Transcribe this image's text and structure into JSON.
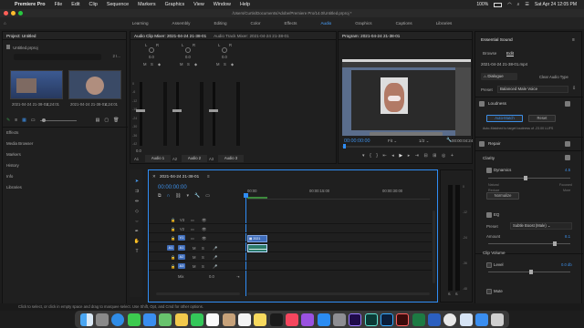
{
  "menubar": {
    "app": "Premiere Pro",
    "items": [
      "File",
      "Edit",
      "Clip",
      "Sequence",
      "Markers",
      "Graphics",
      "View",
      "Window",
      "Help"
    ],
    "battery": "100%",
    "datetime": "Sat Apr 24  12:05 PM"
  },
  "path": "/Users/Curtis/Documents/Adobe/Premiere Pro/14.0/Untitled.prproj *",
  "workspaces": [
    "Learning",
    "Assembly",
    "Editing",
    "Color",
    "Effects",
    "Audio",
    "Graphics",
    "Captions",
    "Libraries"
  ],
  "active_workspace": "Audio",
  "project": {
    "tab": "Project: Untitled",
    "file": "Untitled.prproj",
    "count": "2 I...",
    "items": [
      {
        "name": "2021-04-24 21-38-01...",
        "dur": "4;24:01"
      },
      {
        "name": "2021-04-24 21-38-01...",
        "dur": "4;24:01"
      }
    ],
    "sidebar": [
      "Effects",
      "Media Browser",
      "Markers",
      "History",
      "Info",
      "Libraries"
    ]
  },
  "mixer": {
    "tabs": [
      "Audio Clip Mixer: 2021-04-24 21-38-01",
      "Audio Track Mixer: 2021-04-24 21-38-01"
    ],
    "left_label": "L",
    "right_label": "R",
    "value": "0.0",
    "channel_names": [
      "Audio 1",
      "Audio 2",
      "Audio 3"
    ],
    "channel_ids": [
      "A1",
      "A2",
      "A3"
    ],
    "scale": [
      "0",
      "-6",
      "-12",
      "-18",
      "-24",
      "-30",
      "-36",
      "-42",
      "-48",
      "-54"
    ]
  },
  "program": {
    "tab": "Program: 2021-04-24 21-38-01",
    "timecode": "00:00:00:00",
    "fit": "Fit",
    "ratio": "1/2",
    "duration": "00:00:04:24"
  },
  "essential_sound": {
    "tab": "Essential Sound",
    "subtabs": [
      "Browse",
      "Edit"
    ],
    "clip": "2021-04-24 21-38-01.mp4",
    "type": "Dialogue",
    "clear": "Clear Audio Type",
    "preset_label": "Preset",
    "preset_value": "Balanced Male Voice",
    "loudness": "Loudness",
    "automatch": "Auto-Match",
    "reset": "Reset",
    "note": "Auto-Matched to target loudness of -23.00 LUFS",
    "repair": "Repair",
    "clarity": "Clarity",
    "dynamics": "Dynamics",
    "dyn_value": "4.5",
    "natural": "Natural",
    "focused": "Focused",
    "reduce": "Reduce",
    "more": "More",
    "normalize": "Normalize",
    "eq": "EQ",
    "eq_preset_label": "Preset",
    "eq_preset": "Subtle Boost (Male)",
    "amount": "Amount",
    "amount_value": "8.1",
    "clip_volume": "Clip Volume",
    "level": "Level",
    "level_value": "0.0 db",
    "mute": "Mute"
  },
  "timeline": {
    "tab": "2021-04-24 21-38-01",
    "timecode": "00:00:00:00",
    "ruler": [
      "00:00",
      "00:00:15:00",
      "00:00:30:00"
    ],
    "video_tracks": [
      "V3",
      "V2",
      "V1"
    ],
    "audio_tracks": [
      "A1",
      "A2",
      "A3"
    ],
    "mix": "Mix",
    "mix_value": "0.0",
    "clip_label": "2021",
    "meter_bottom": [
      "S",
      "S"
    ]
  },
  "status": "Click to select, or click in empty space and drag to marquee select. Use Shift, Opt, and Cmd for other options.",
  "colors": {
    "accent": "#3d8fe8",
    "clip_video": "#3f6dbb",
    "clip_audio": "#2b7a6a",
    "playhead": "#2f8df5"
  }
}
